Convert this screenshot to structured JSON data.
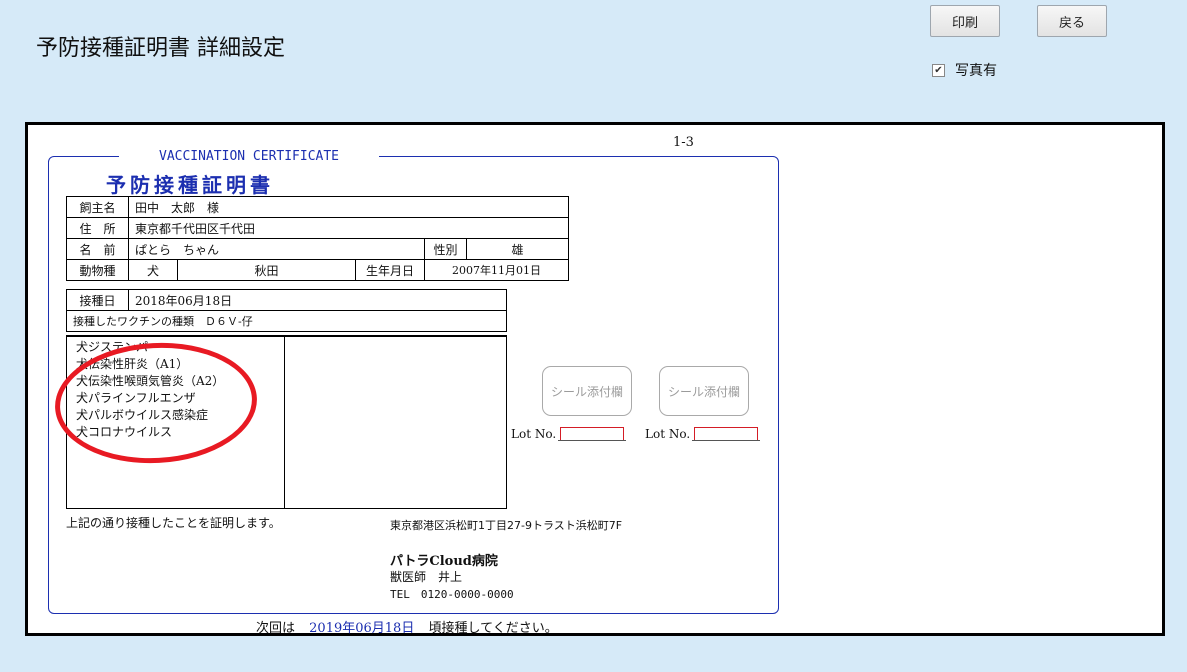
{
  "header": {
    "title": "予防接種証明書 詳細設定",
    "print_label": "印刷",
    "back_label": "戻る",
    "photo_label": "写真有",
    "photo_checked": true
  },
  "certificate": {
    "page_number": "1-3",
    "title_en": "VACCINATION CERTIFICATE",
    "title_jp": "予防接種証明書",
    "owner_label": "飼主名",
    "owner_value": "田中　太郎　様",
    "address_label": "住　所",
    "address_value": "東京都千代田区千代田",
    "name_label": "名　前",
    "name_value": "ぱとら　ちゃん",
    "sex_label": "性別",
    "sex_value": "雄",
    "species_label": "動物種",
    "species_value": "犬",
    "breed_value": "秋田",
    "birth_label": "生年月日",
    "birth_value": "2007年11月01日",
    "vaccination_date_label": "接種日",
    "vaccination_date_value": "2018年06月18日",
    "vaccine_type_text": "接種したワクチンの種類　Ｄ６Ｖ-仔",
    "vaccines": [
      "犬ジステンパー",
      "犬伝染性肝炎（A1）",
      "犬伝染性喉頭気管炎（A2）",
      "犬パラインフルエンザ",
      "犬パルボウイルス感染症",
      "犬コロナウイルス"
    ],
    "seal_label": "シール添付欄",
    "lot_label": "Lot No.",
    "certify_text": "上記の通り接種したことを証明します。",
    "clinic_address": "東京都港区浜松町1丁目27-9トラスト浜松町7F",
    "hospital_name": "パトラCloud病院",
    "doctor": "獣医師　井上",
    "tel": "TEL　0120-0000-0000",
    "next_prefix": "次回は",
    "next_date": "2019年06月18日",
    "next_suffix": "頃接種してください。"
  },
  "colors": {
    "background": "#d6eaf8",
    "accent_blue": "#1c2fb0",
    "highlight_red": "#e81a23"
  }
}
